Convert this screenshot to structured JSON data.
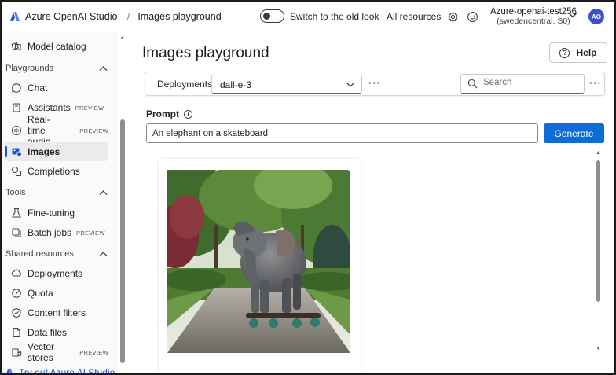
{
  "header": {
    "brand": "Azure OpenAI Studio",
    "separator": "/",
    "breadcrumb_page": "Images playground",
    "toggle_label": "Switch to the old look",
    "all_resources": "All resources",
    "account_name": "Azure-openai-test256",
    "account_region": "(swedencentral, S0)",
    "avatar_initials": "AO"
  },
  "sidebar": {
    "top_item": {
      "label": "Model catalog",
      "icon": "model-catalog-icon"
    },
    "sections": [
      {
        "title": "Playgrounds",
        "items": [
          {
            "label": "Chat",
            "icon": "chat-icon"
          },
          {
            "label": "Assistants",
            "badge": "PREVIEW",
            "icon": "assistants-icon"
          },
          {
            "label": "Real-time audio",
            "line1": "Real-time",
            "line2": "audio",
            "badge": "PREVIEW",
            "icon": "audio-icon"
          },
          {
            "label": "Images",
            "icon": "images-icon",
            "active": true
          },
          {
            "label": "Completions",
            "icon": "completions-icon"
          }
        ]
      },
      {
        "title": "Tools",
        "items": [
          {
            "label": "Fine-tuning",
            "icon": "flask-icon"
          },
          {
            "label": "Batch jobs",
            "badge": "PREVIEW",
            "icon": "batch-icon"
          }
        ]
      },
      {
        "title": "Shared resources",
        "items": [
          {
            "label": "Deployments",
            "icon": "deployments-icon"
          },
          {
            "label": "Quota",
            "icon": "quota-icon"
          },
          {
            "label": "Content filters",
            "icon": "shield-icon"
          },
          {
            "label": "Data files",
            "icon": "data-files-icon"
          },
          {
            "label": "Vector stores",
            "badge": "PREVIEW",
            "icon": "vector-stores-icon"
          }
        ]
      }
    ],
    "footer_link": "Try out Azure AI Studio"
  },
  "main": {
    "title": "Images playground",
    "help_label": "Help",
    "deployments_label": "Deployments",
    "deployment_value": "dall-e-3",
    "search_placeholder": "Search",
    "prompt_label": "Prompt",
    "prompt_value": "An elephant on a skateboard",
    "generate_label": "Generate",
    "generated_image_alt": "An elephant on a skateboard"
  },
  "colors": {
    "accent": "#0f6cd6",
    "active_indicator": "#1a55d6",
    "avatar": "#3f51d1"
  }
}
